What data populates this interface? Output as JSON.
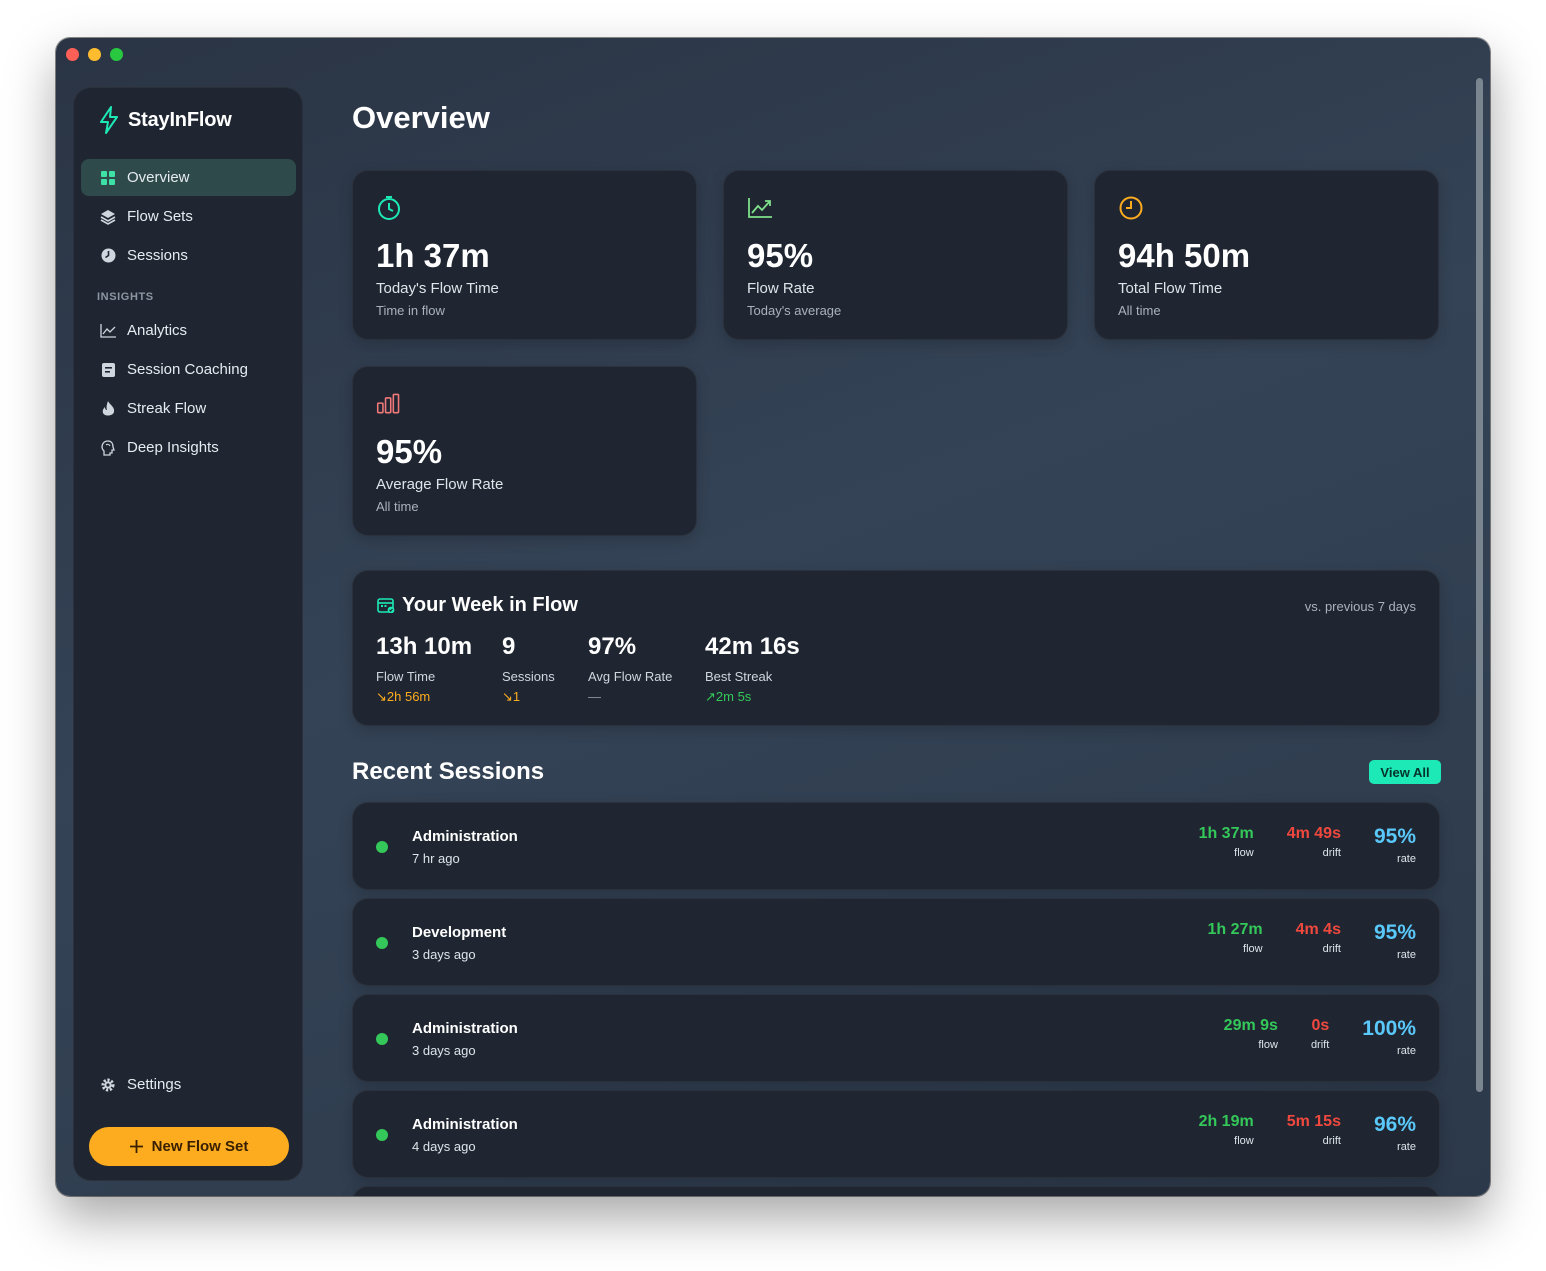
{
  "app": {
    "name": "StayInFlow",
    "accent": "#1de9b6"
  },
  "sidebar": {
    "items": [
      {
        "label": "Overview",
        "icon": "grid-icon"
      },
      {
        "label": "Flow Sets",
        "icon": "layers-icon"
      },
      {
        "label": "Sessions",
        "icon": "clock-pie-icon"
      }
    ],
    "insights_title": "INSIGHTS",
    "insight_items": [
      {
        "label": "Analytics",
        "icon": "line-chart-icon"
      },
      {
        "label": "Session Coaching",
        "icon": "clipboard-icon"
      },
      {
        "label": "Streak Flow",
        "icon": "flame-icon"
      },
      {
        "label": "Deep Insights",
        "icon": "brain-icon"
      }
    ],
    "settings_label": "Settings",
    "new_flow_label": "New Flow Set"
  },
  "page": {
    "title": "Overview"
  },
  "stats": [
    {
      "value": "1h 37m",
      "label": "Today's Flow Time",
      "sub": "Time in flow",
      "icon": "timer-icon"
    },
    {
      "value": "95%",
      "label": "Flow Rate",
      "sub": "Today's average",
      "icon": "trend-up-icon"
    },
    {
      "value": "94h 50m",
      "label": "Total Flow Time",
      "sub": "All time",
      "icon": "clock-icon"
    },
    {
      "value": "95%",
      "label": "Average Flow Rate",
      "sub": "All time",
      "icon": "bar-chart-icon"
    }
  ],
  "week": {
    "title": "Your Week in Flow",
    "vs_label": "vs. previous 7 days",
    "stats": [
      {
        "value": "13h 10m",
        "label": "Flow Time",
        "delta": "↘2h 56m",
        "delta_color": "#fdac1f"
      },
      {
        "value": "9",
        "label": "Sessions",
        "delta": "↘1",
        "delta_color": "#fdac1f"
      },
      {
        "value": "97%",
        "label": "Avg Flow Rate",
        "delta": "—",
        "delta_color": "#8c96a3"
      },
      {
        "value": "42m 16s",
        "label": "Best Streak",
        "delta": "↗2m 5s",
        "delta_color": "#34c759"
      }
    ]
  },
  "recent": {
    "title": "Recent Sessions",
    "view_all_label": "View All",
    "flow_label": "flow",
    "drift_label": "drift",
    "rate_label": "rate",
    "sessions": [
      {
        "name": "Administration",
        "time": "7 hr ago",
        "flow": "1h 37m",
        "drift": "4m 49s",
        "rate": "95%"
      },
      {
        "name": "Development",
        "time": "3 days ago",
        "flow": "1h 27m",
        "drift": "4m 4s",
        "rate": "95%"
      },
      {
        "name": "Administration",
        "time": "3 days ago",
        "flow": "29m 9s",
        "drift": "0s",
        "rate": "100%"
      },
      {
        "name": "Administration",
        "time": "4 days ago",
        "flow": "2h 19m",
        "drift": "5m 15s",
        "rate": "96%"
      }
    ]
  }
}
